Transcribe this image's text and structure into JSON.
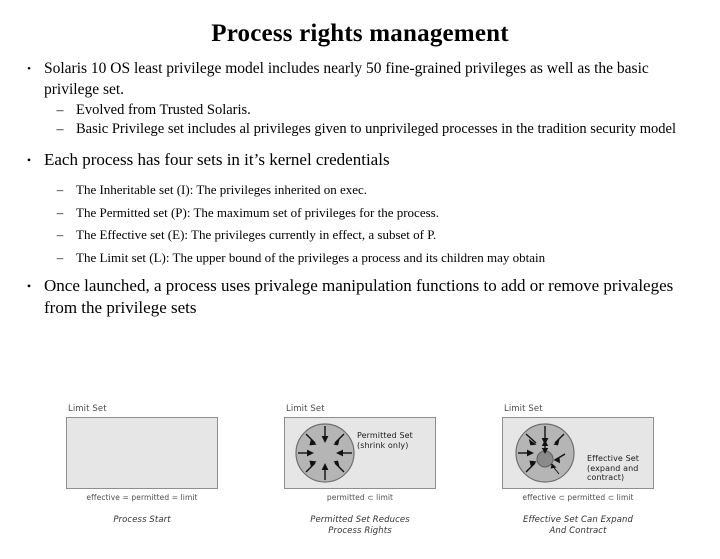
{
  "slide": {
    "title": "Process rights management",
    "bullets": [
      {
        "marker": "•",
        "text": "Solaris 10 OS least privilege model includes nearly 50 fine-grained privileges as well as the basic privilege set.",
        "sub": [
          {
            "marker": "–",
            "text": "Evolved from Trusted Solaris."
          },
          {
            "marker": "–",
            "text": "Basic Privilege set includes al privileges given to unprivileged processes in the tradition security model"
          }
        ]
      },
      {
        "marker": "•",
        "text": "Each process has four sets in it’s kernel credentials",
        "sub": [
          {
            "marker": "–",
            "text": "The Inheritable set (I): The privileges inherited on exec."
          },
          {
            "marker": "–",
            "text": "The Permitted set (P): The maximum set of privileges for the process."
          },
          {
            "marker": "–",
            "text": "The Effective set (E): The privileges currently in effect, a subset of P."
          },
          {
            "marker": "–",
            "text": "The Limit set (L): The upper bound of the privileges a process and its children may obtain"
          }
        ]
      },
      {
        "marker": "•",
        "text": "Once launched, a process uses privalege manipulation functions to add or remove privaleges from the privilege sets",
        "sub": []
      }
    ]
  },
  "diagrams": [
    {
      "box_label": "Limit Set",
      "inset_label": "",
      "caption": "effective = permitted = limit",
      "title": "Process Start",
      "shape": "empty"
    },
    {
      "box_label": "Limit Set",
      "inset_label": "Permitted Set\n(shrink only)",
      "inset_label_line1": "Permitted Set",
      "inset_label_line2": "(shrink only)",
      "caption": "permitted ⊂ limit",
      "title_line1": "Permitted Set Reduces",
      "title_line2": "Process Rights",
      "shape": "circle-inward"
    },
    {
      "box_label": "Limit Set",
      "inset_label_line1": "Effective Set",
      "inset_label_line2": "(expand and",
      "inset_label_line3": "contract)",
      "caption": "effective ⊂ permitted ⊂ limit",
      "title_line1": "Effective Set Can Expand",
      "title_line2": "And Contract",
      "shape": "circle-nested"
    }
  ],
  "colors": {
    "box_fill": "#e6e6e6",
    "box_border": "#8e8e8e",
    "circle_fill": "#b5b5b5",
    "circle_border": "#6e6e6e",
    "inner_circle_fill": "#8a8a8a",
    "text": "#000000",
    "caption_text": "#4f4f4f"
  }
}
